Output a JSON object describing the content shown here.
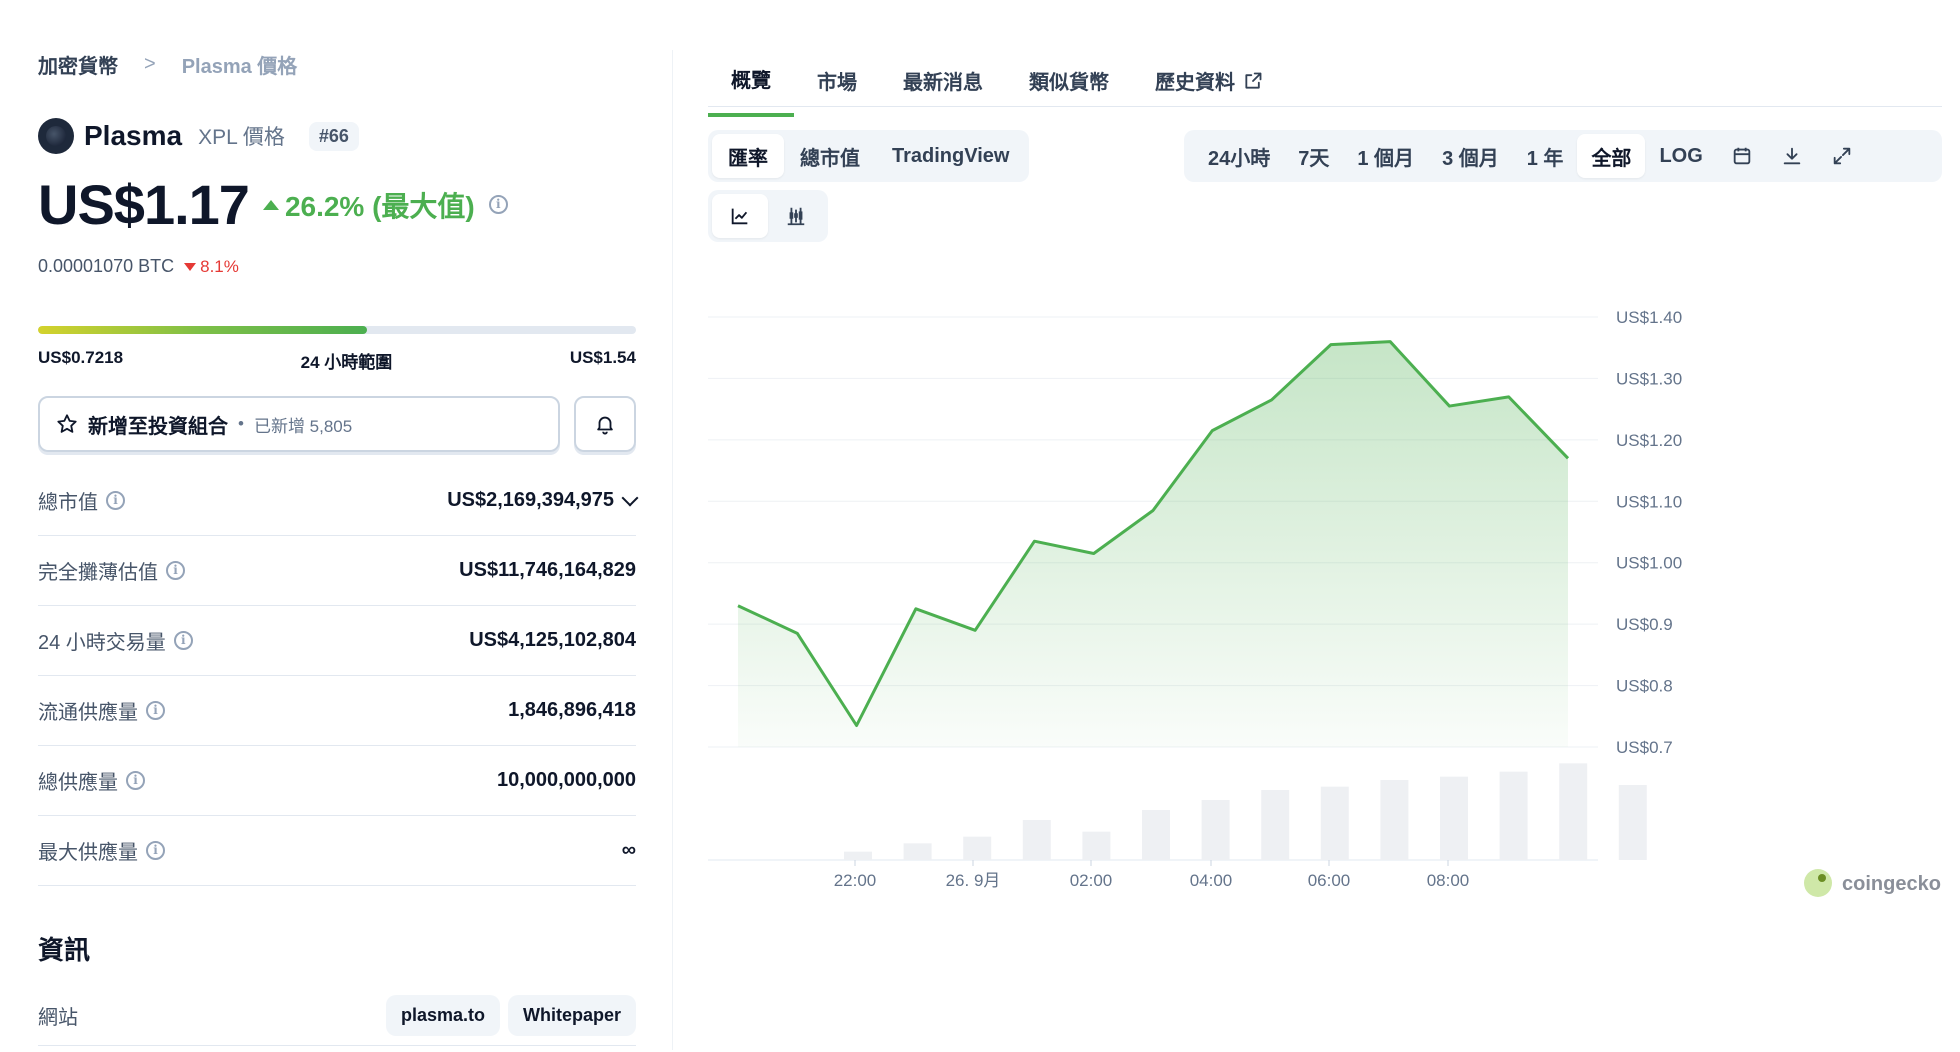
{
  "breadcrumb": {
    "root": "加密貨幣",
    "sep": ">",
    "current": "Plasma 價格"
  },
  "coin": {
    "name": "Plasma",
    "symbol_label": "XPL 價格",
    "rank": "#66",
    "price": "US$1.17",
    "change": "26.2% (最大值)",
    "btc_price": "0.00001070 BTC",
    "btc_change": "8.1%"
  },
  "range24h": {
    "low": "US$0.7218",
    "label": "24 小時範圍",
    "high": "US$1.54",
    "fill_fraction": 0.55
  },
  "portfolio": {
    "add_label": "新增至投資組合",
    "dot": "•",
    "added": "已新增 5,805"
  },
  "stats": [
    {
      "label": "總市值",
      "value": "US$2,169,394,975"
    },
    {
      "label": "完全攤薄估值",
      "value": "US$11,746,164,829"
    },
    {
      "label": "24 小時交易量",
      "value": "US$4,125,102,804"
    },
    {
      "label": "流通供應量",
      "value": "1,846,896,418"
    },
    {
      "label": "總供應量",
      "value": "10,000,000,000"
    },
    {
      "label": "最大供應量",
      "value": "∞"
    }
  ],
  "info": {
    "heading": "資訊",
    "website_label": "網站",
    "links": [
      "plasma.to",
      "Whitepaper"
    ]
  },
  "tabs": [
    "概覽",
    "市場",
    "最新消息",
    "類似貨幣",
    "歷史資料"
  ],
  "chart_modes": [
    "匯率",
    "總市值",
    "TradingView"
  ],
  "ranges": [
    "24小時",
    "7天",
    "1 個月",
    "3 個月",
    "1 年",
    "全部",
    "LOG"
  ],
  "active_range": "全部",
  "icons": {
    "star": "star-icon",
    "bell": "bell-icon",
    "calendar": "calendar-icon",
    "download": "download-icon",
    "expand": "expand-icon",
    "line": "line-chart-icon",
    "candle": "candlestick-icon",
    "external": "external-link-icon"
  },
  "colors": {
    "accent": "#4caf50",
    "down": "#e53935"
  },
  "chart_data": {
    "type": "line",
    "x_tick_labels": [
      "22:00",
      "26. 9月",
      "02:00",
      "04:00",
      "06:00",
      "08:00"
    ],
    "y_tick_labels": [
      "US$1.40",
      "US$1.30",
      "US$1.20",
      "US$1.10",
      "US$1.00",
      "US$0.9",
      "US$0.8",
      "US$0.7"
    ],
    "ylim": [
      0.7,
      1.4
    ],
    "grid": true,
    "price": [
      0.93,
      0.885,
      0.735,
      0.925,
      0.89,
      1.035,
      1.015,
      1.085,
      1.215,
      1.265,
      1.355,
      1.36,
      1.255,
      1.27,
      1.17
    ],
    "volume": [
      0.05,
      0.1,
      0.14,
      0.24,
      0.17,
      0.3,
      0.36,
      0.42,
      0.44,
      0.48,
      0.5,
      0.53,
      0.58,
      0.45
    ],
    "watermark": "coingecko"
  }
}
